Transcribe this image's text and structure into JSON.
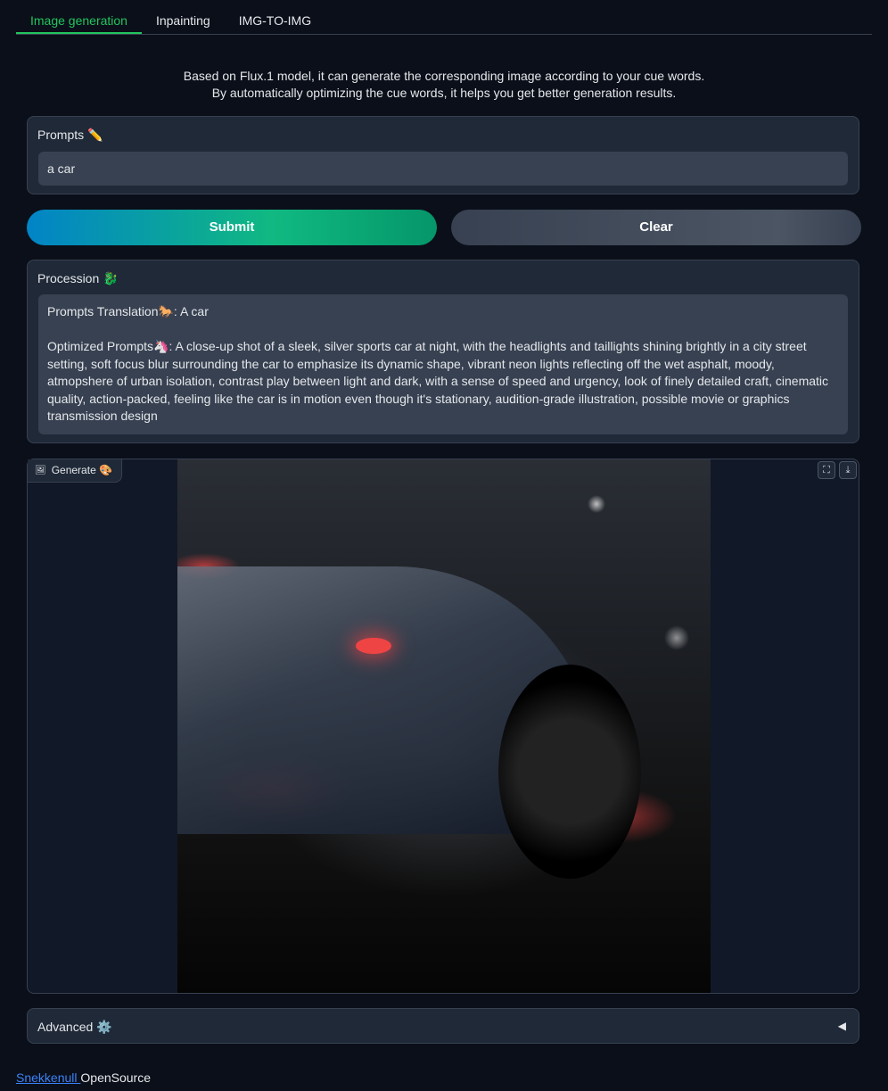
{
  "tabs": [
    {
      "label": "Image generation",
      "active": true
    },
    {
      "label": "Inpainting",
      "active": false
    },
    {
      "label": "IMG-TO-IMG",
      "active": false
    }
  ],
  "description": {
    "line1": "Based on Flux.1 model, it can generate the corresponding image according to your cue words.",
    "line2": "By automatically optimizing the cue words, it helps you get better generation results."
  },
  "prompts": {
    "label": "Prompts ✏️",
    "value": "a car"
  },
  "buttons": {
    "submit": "Submit",
    "clear": "Clear"
  },
  "procession": {
    "label": "Procession 🐉",
    "translation_label": "Prompts Translation🐎:",
    "translation_value": "A car",
    "optimized_label": "Optimized Prompts🦄:",
    "optimized_value": "A close-up shot of a sleek, silver sports car at night, with the headlights and taillights shining brightly in a city street setting, soft focus blur surrounding the car to emphasize its dynamic shape, vibrant neon lights reflecting off the wet asphalt, moody, atmopshere of urban isolation, contrast play between light and dark, with a sense of speed and urgency, look of finely detailed craft, cinematic quality, action-packed, feeling like the car is in motion even though it's stationary, audition-grade illustration, possible movie or graphics transmission design"
  },
  "generate": {
    "label": "Generate 🎨",
    "image_alt": "silver sports car at night"
  },
  "advanced": {
    "label": "Advanced ⚙️",
    "arrow": "◀"
  },
  "footer": {
    "link": "Snekkenull ",
    "text": "OpenSource"
  },
  "colors": {
    "accent": "#22c55e",
    "background": "#0b0f19",
    "panel": "#1f2937",
    "link": "#3b82f6"
  }
}
